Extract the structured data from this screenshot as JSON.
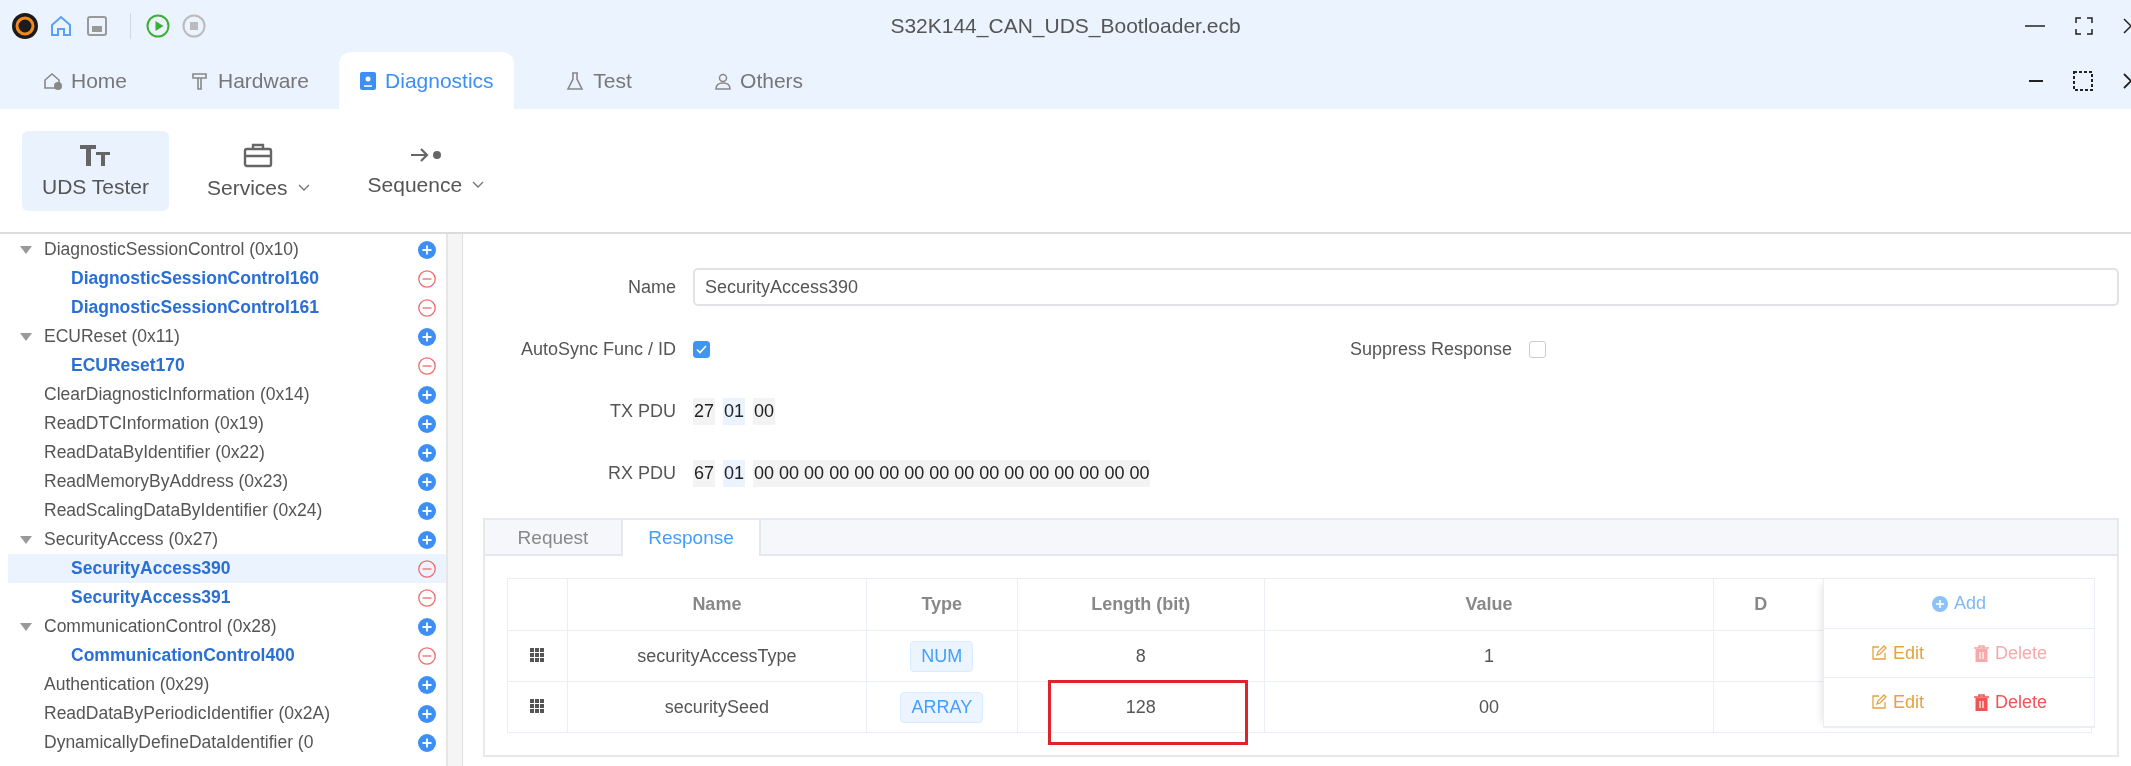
{
  "window": {
    "title": "S32K144_CAN_UDS_Bootloader.ecb"
  },
  "tabs": [
    {
      "label": "Home",
      "selected": false,
      "kind": "home"
    },
    {
      "label": "Hardware",
      "selected": false,
      "kind": "hardware"
    },
    {
      "label": "Diagnostics",
      "selected": true,
      "kind": "diagnostics"
    },
    {
      "label": "Test",
      "selected": false,
      "kind": "test"
    },
    {
      "label": "Others",
      "selected": false,
      "kind": "others"
    }
  ],
  "toolbar": [
    {
      "label": "UDS Tester",
      "selected": true,
      "kind": "tester",
      "dropdown": false
    },
    {
      "label": "Services",
      "selected": false,
      "kind": "services",
      "dropdown": true
    },
    {
      "label": "Sequence",
      "selected": false,
      "kind": "sequence",
      "dropdown": true
    }
  ],
  "tree": [
    {
      "label": "DiagnosticSessionControl (0x10)",
      "selected": false,
      "expanded": true,
      "children": [
        {
          "label": "DiagnosticSessionControl160",
          "selected": false
        },
        {
          "label": "DiagnosticSessionControl161",
          "selected": false
        }
      ]
    },
    {
      "label": "ECUReset (0x11)",
      "selected": false,
      "expanded": true,
      "children": [
        {
          "label": "ECUReset170",
          "selected": false
        }
      ]
    },
    {
      "label": "ClearDiagnosticInformation (0x14)",
      "selected": false
    },
    {
      "label": "ReadDTCInformation (0x19)",
      "selected": false
    },
    {
      "label": "ReadDataByIdentifier (0x22)",
      "selected": false
    },
    {
      "label": "ReadMemoryByAddress (0x23)",
      "selected": false
    },
    {
      "label": "ReadScalingDataByIdentifier (0x24)",
      "selected": false
    },
    {
      "label": "SecurityAccess (0x27)",
      "selected": false,
      "expanded": true,
      "children": [
        {
          "label": "SecurityAccess390",
          "selected": true
        },
        {
          "label": "SecurityAccess391",
          "selected": false
        }
      ]
    },
    {
      "label": "CommunicationControl (0x28)",
      "selected": false,
      "expanded": true,
      "children": [
        {
          "label": "CommunicationControl400",
          "selected": false
        }
      ]
    },
    {
      "label": "Authentication (0x29)",
      "selected": false
    },
    {
      "label": "ReadDataByPeriodicIdentifier (0x2A)",
      "selected": false
    },
    {
      "label": "DynamicallyDefineDataIdentifier (0",
      "selected": false
    }
  ],
  "form": {
    "name_label": "Name",
    "name_value": "SecurityAccess390",
    "autosync_label": "AutoSync Func / ID",
    "autosync_checked": true,
    "suppress_label": "Suppress Response",
    "suppress_checked": false,
    "tx_label": "TX PDU",
    "tx_bytes": [
      {
        "text": "27",
        "kind": "service"
      },
      {
        "text": "01",
        "kind": "subfunction"
      },
      {
        "text": "00",
        "kind": "data"
      }
    ],
    "rx_label": "RX PDU",
    "rx_bytes": [
      {
        "text": "67",
        "kind": "service"
      },
      {
        "text": "01",
        "kind": "subfunction"
      },
      {
        "text": "00 00 00 00 00 00 00 00 00 00 00 00 00 00 00 00",
        "kind": "data"
      }
    ]
  },
  "subtabs": [
    {
      "label": "Request",
      "selected": false
    },
    {
      "label": "Response",
      "selected": true
    }
  ],
  "table": {
    "columns": [
      "Name",
      "Type",
      "Length (bit)",
      "Value",
      "D"
    ],
    "add_label": "Add",
    "rows": [
      {
        "name": "securityAccessType",
        "type": "NUM",
        "length": "8",
        "value": "1",
        "length_highlighted": false,
        "edit": "Edit",
        "delete": "Delete",
        "delete_disabled": true
      },
      {
        "name": "securitySeed",
        "type": "ARRAY",
        "length": "128",
        "value": "00",
        "length_highlighted": true,
        "edit": "Edit",
        "delete": "Delete",
        "delete_disabled": false
      }
    ]
  }
}
